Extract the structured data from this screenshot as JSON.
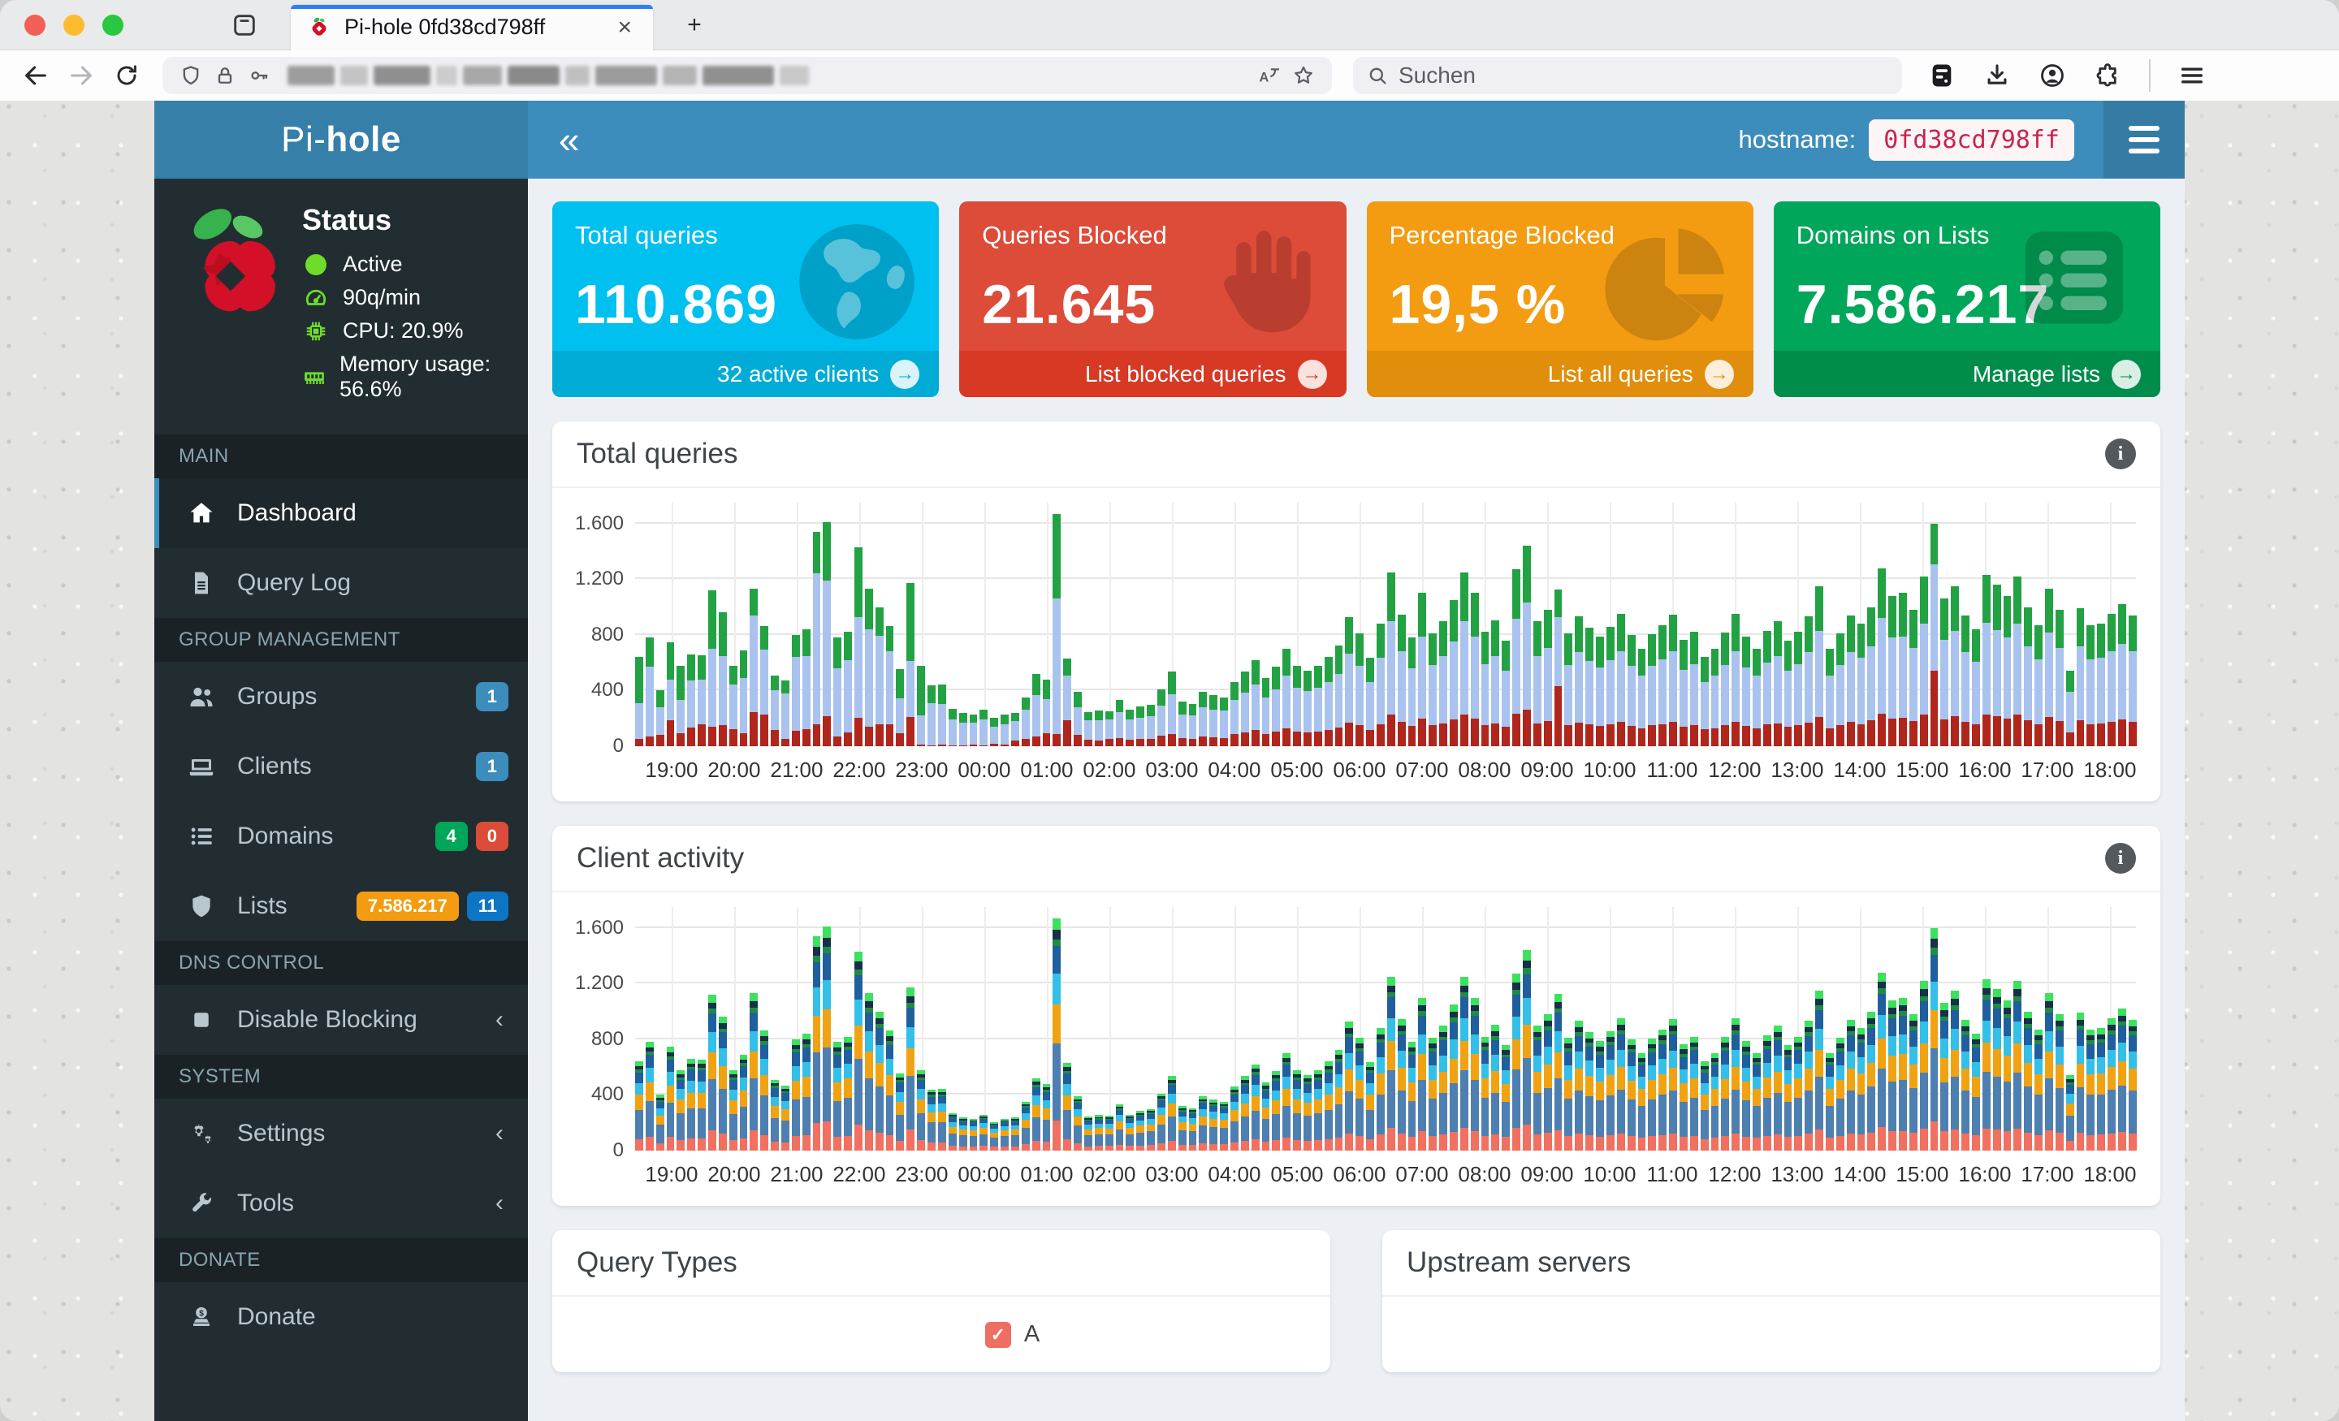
{
  "browser": {
    "tab": {
      "title": "Pi-hole 0fd38cd798ff",
      "close_glyph": "×",
      "new_tab_glyph": "+"
    },
    "toolbar": {
      "search_placeholder": "Suchen"
    }
  },
  "app_header": {
    "brand_light": "Pi-",
    "brand_bold": "hole",
    "collapse_glyph": "«",
    "hostname_label": "hostname:",
    "hostname_value": "0fd38cd798ff"
  },
  "sidebar": {
    "status": {
      "title": "Status",
      "rows": [
        {
          "icon": "dot",
          "label": "Active"
        },
        {
          "icon": "gauge",
          "label": "90q/min"
        },
        {
          "icon": "cpu",
          "label": "CPU: 20.9%"
        },
        {
          "icon": "memory",
          "label": "Memory usage: 56.6%"
        }
      ]
    },
    "sections": [
      {
        "header": "MAIN",
        "items": [
          {
            "icon": "home",
            "label": "Dashboard",
            "active": true
          },
          {
            "icon": "file",
            "label": "Query Log"
          }
        ]
      },
      {
        "header": "GROUP MANAGEMENT",
        "items": [
          {
            "icon": "users",
            "label": "Groups",
            "badges": [
              {
                "text": "1",
                "color": "#3c8dbc"
              }
            ]
          },
          {
            "icon": "laptop",
            "label": "Clients",
            "badges": [
              {
                "text": "1",
                "color": "#3c8dbc"
              }
            ]
          },
          {
            "icon": "list",
            "label": "Domains",
            "badges": [
              {
                "text": "4",
                "color": "#00a65a"
              },
              {
                "text": "0",
                "color": "#dd4b39"
              }
            ]
          },
          {
            "icon": "shield",
            "label": "Lists",
            "badges": [
              {
                "text": "7.586.217",
                "color": "#f39c12"
              },
              {
                "text": "11",
                "color": "#0d76c4"
              }
            ]
          }
        ]
      },
      {
        "header": "DNS CONTROL",
        "items": [
          {
            "icon": "stop",
            "label": "Disable Blocking",
            "chevron": "‹"
          }
        ]
      },
      {
        "header": "SYSTEM",
        "items": [
          {
            "icon": "gears",
            "label": "Settings",
            "chevron": "‹"
          },
          {
            "icon": "wrench",
            "label": "Tools",
            "chevron": "‹"
          }
        ]
      },
      {
        "header": "DONATE",
        "items": [
          {
            "icon": "donate",
            "label": "Donate"
          }
        ]
      }
    ]
  },
  "cards": [
    {
      "title": "Total queries",
      "value": "110.869",
      "footer": "32 active clients",
      "color": "#00c0ef",
      "footer_color": "#00acd6",
      "icon": "globe"
    },
    {
      "title": "Queries Blocked",
      "value": "21.645",
      "footer": "List blocked queries",
      "color": "#dd4b39",
      "footer_color": "#d73925",
      "icon": "hand"
    },
    {
      "title": "Percentage Blocked",
      "value": "19,5 %",
      "footer": "List all queries",
      "color": "#f39c12",
      "footer_color": "#e08e0b",
      "icon": "pie"
    },
    {
      "title": "Domains on Lists",
      "value": "7.586.217",
      "footer": "Manage lists",
      "color": "#00a65a",
      "footer_color": "#008d4c",
      "icon": "serverlist"
    }
  ],
  "panels": {
    "total_queries": {
      "title": "Total queries"
    },
    "client_activity": {
      "title": "Client activity"
    },
    "query_types": {
      "title": "Query Types",
      "legend": [
        {
          "label": "A",
          "color": "#ee6e63",
          "checked": true
        }
      ]
    },
    "upstream_servers": {
      "title": "Upstream servers"
    }
  },
  "chart_data": [
    {
      "id": "total-queries",
      "type": "bar",
      "stacked": true,
      "title": "Total queries",
      "ylim": [
        0,
        1750
      ],
      "y_ticks": [
        0,
        400,
        800,
        1200,
        1600
      ],
      "y_tick_labels": [
        "0",
        "400",
        "800",
        "1.200",
        "1.600"
      ],
      "x_ticks": [
        "19:00",
        "20:00",
        "21:00",
        "22:00",
        "23:00",
        "00:00",
        "01:00",
        "02:00",
        "03:00",
        "04:00",
        "05:00",
        "06:00",
        "07:00",
        "08:00",
        "09:00",
        "10:00",
        "11:00",
        "12:00",
        "13:00",
        "14:00",
        "15:00",
        "16:00",
        "17:00",
        "18:00"
      ],
      "bars_per_tick": 6,
      "tick_offset": 3,
      "interval_minutes": 10,
      "colors": {
        "blocked": "#b0261c",
        "cached": "#a9c3ee",
        "permitted": "#23a244"
      },
      "series_order_bottom_to_top": [
        "blocked",
        "cached",
        "permitted"
      ],
      "totals": [
        640,
        780,
        400,
        745,
        580,
        660,
        655,
        1120,
        965,
        575,
        690,
        1130,
        865,
        510,
        470,
        800,
        840,
        1540,
        1610,
        780,
        820,
        1430,
        1130,
        1000,
        865,
        555,
        1170,
        580,
        440,
        445,
        270,
        240,
        230,
        260,
        205,
        230,
        240,
        350,
        520,
        480,
        1670,
        630,
        390,
        245,
        255,
        250,
        335,
        260,
        285,
        300,
        410,
        535,
        320,
        305,
        390,
        365,
        350,
        460,
        535,
        620,
        490,
        570,
        700,
        580,
        545,
        580,
        640,
        725,
        925,
        810,
        635,
        880,
        1250,
        945,
        780,
        1100,
        810,
        900,
        1050,
        1250,
        1100,
        820,
        905,
        760,
        1270,
        1440,
        900,
        980,
        1125,
        810,
        935,
        850,
        785,
        860,
        950,
        800,
        700,
        805,
        870,
        945,
        765,
        820,
        640,
        700,
        815,
        950,
        785,
        700,
        830,
        900,
        760,
        820,
        935,
        1150,
        700,
        810,
        940,
        880,
        1000,
        1280,
        1080,
        1100,
        980,
        1220,
        1600,
        1060,
        1150,
        940,
        840,
        1230,
        1160,
        1080,
        1220,
        1000,
        870,
        1130,
        980,
        540,
        990,
        870,
        880,
        950,
        1020,
        940
      ],
      "blocked": [
        50,
        70,
        80,
        185,
        95,
        135,
        155,
        140,
        150,
        120,
        95,
        245,
        225,
        115,
        55,
        110,
        120,
        160,
        215,
        70,
        100,
        205,
        140,
        155,
        160,
        95,
        210,
        10,
        5,
        10,
        5,
        5,
        10,
        5,
        15,
        10,
        40,
        50,
        70,
        95,
        90,
        185,
        80,
        45,
        40,
        50,
        60,
        45,
        50,
        55,
        75,
        90,
        60,
        55,
        70,
        65,
        60,
        85,
        100,
        115,
        90,
        105,
        130,
        105,
        100,
        105,
        115,
        135,
        170,
        150,
        115,
        160,
        230,
        175,
        145,
        200,
        150,
        165,
        195,
        230,
        200,
        150,
        165,
        140,
        235,
        265,
        165,
        180,
        430,
        150,
        170,
        155,
        145,
        160,
        175,
        145,
        130,
        150,
        160,
        175,
        140,
        150,
        120,
        130,
        150,
        175,
        145,
        130,
        155,
        165,
        140,
        150,
        170,
        210,
        130,
        150,
        175,
        160,
        185,
        235,
        200,
        205,
        180,
        225,
        545,
        195,
        215,
        175,
        155,
        230,
        215,
        200,
        225,
        185,
        160,
        210,
        180,
        100,
        185,
        160,
        165,
        175,
        190,
        175
      ],
      "permitted": [
        330,
        210,
        120,
        265,
        250,
        190,
        175,
        420,
        320,
        130,
        200,
        190,
        170,
        105,
        90,
        160,
        190,
        300,
        420,
        220,
        200,
        500,
        290,
        205,
        180,
        210,
        555,
        360,
        130,
        140,
        80,
        70,
        60,
        70,
        65,
        75,
        60,
        90,
        150,
        140,
        610,
        120,
        110,
        60,
        70,
        60,
        90,
        70,
        80,
        85,
        120,
        160,
        90,
        85,
        110,
        100,
        95,
        130,
        150,
        175,
        140,
        160,
        195,
        160,
        150,
        160,
        180,
        205,
        260,
        230,
        175,
        245,
        350,
        265,
        220,
        310,
        225,
        250,
        295,
        350,
        310,
        230,
        255,
        215,
        355,
        405,
        250,
        275,
        200,
        225,
        260,
        240,
        220,
        240,
        265,
        225,
        195,
        225,
        245,
        265,
        215,
        230,
        180,
        195,
        230,
        265,
        220,
        195,
        230,
        250,
        215,
        230,
        260,
        320,
        195,
        225,
        265,
        245,
        280,
        360,
        300,
        310,
        275,
        340,
        295,
        295,
        320,
        265,
        235,
        345,
        325,
        300,
        340,
        280,
        245,
        315,
        275,
        150,
        275,
        245,
        245,
        265,
        285,
        260
      ]
    },
    {
      "id": "client-activity",
      "type": "bar",
      "stacked": true,
      "title": "Client activity",
      "ylim": [
        0,
        1750
      ],
      "y_ticks": [
        0,
        400,
        800,
        1200,
        1600
      ],
      "y_tick_labels": [
        "0",
        "400",
        "800",
        "1.200",
        "1.600"
      ],
      "x_ticks": [
        "19:00",
        "20:00",
        "21:00",
        "22:00",
        "23:00",
        "00:00",
        "01:00",
        "02:00",
        "03:00",
        "04:00",
        "05:00",
        "06:00",
        "07:00",
        "08:00",
        "09:00",
        "10:00",
        "11:00",
        "12:00",
        "13:00",
        "14:00",
        "15:00",
        "16:00",
        "17:00",
        "18:00"
      ],
      "bars_per_tick": 6,
      "tick_offset": 3,
      "interval_minutes": 10,
      "totals": [
        640,
        780,
        400,
        745,
        580,
        660,
        655,
        1120,
        965,
        575,
        690,
        1130,
        865,
        510,
        470,
        800,
        840,
        1540,
        1610,
        780,
        820,
        1430,
        1130,
        1000,
        865,
        555,
        1170,
        580,
        440,
        445,
        270,
        240,
        230,
        260,
        205,
        230,
        240,
        350,
        520,
        480,
        1670,
        630,
        390,
        245,
        255,
        250,
        335,
        260,
        285,
        300,
        410,
        535,
        320,
        305,
        390,
        365,
        350,
        460,
        535,
        620,
        490,
        570,
        700,
        580,
        545,
        580,
        640,
        725,
        925,
        810,
        635,
        880,
        1250,
        945,
        780,
        1100,
        810,
        900,
        1050,
        1250,
        1100,
        820,
        905,
        760,
        1270,
        1440,
        900,
        980,
        1125,
        810,
        935,
        850,
        785,
        860,
        950,
        800,
        700,
        805,
        870,
        945,
        765,
        820,
        640,
        700,
        815,
        950,
        785,
        700,
        830,
        900,
        760,
        820,
        935,
        1150,
        700,
        810,
        940,
        880,
        1000,
        1280,
        1080,
        1100,
        980,
        1220,
        1600,
        1060,
        1150,
        940,
        840,
        1230,
        1160,
        1080,
        1220,
        1000,
        870,
        1130,
        980,
        540,
        990,
        870,
        880,
        950,
        1020,
        940
      ],
      "clients_bottom_to_top": [
        {
          "id": "client-1",
          "color": "#f1705f",
          "share": 0.13
        },
        {
          "id": "client-2",
          "color": "#4e7fb1",
          "share": 0.33
        },
        {
          "id": "client-3",
          "color": "#f0a312",
          "share": 0.17
        },
        {
          "id": "client-4",
          "color": "#33bfe8",
          "share": 0.13
        },
        {
          "id": "client-5",
          "color": "#1f5f9e",
          "share": 0.12
        },
        {
          "id": "client-6",
          "color": "#208b45",
          "share": 0.03
        },
        {
          "id": "client-7",
          "color": "#17304a",
          "share": 0.04
        },
        {
          "id": "client-8",
          "color": "#3ce15e",
          "share": 0.05
        }
      ]
    }
  ]
}
